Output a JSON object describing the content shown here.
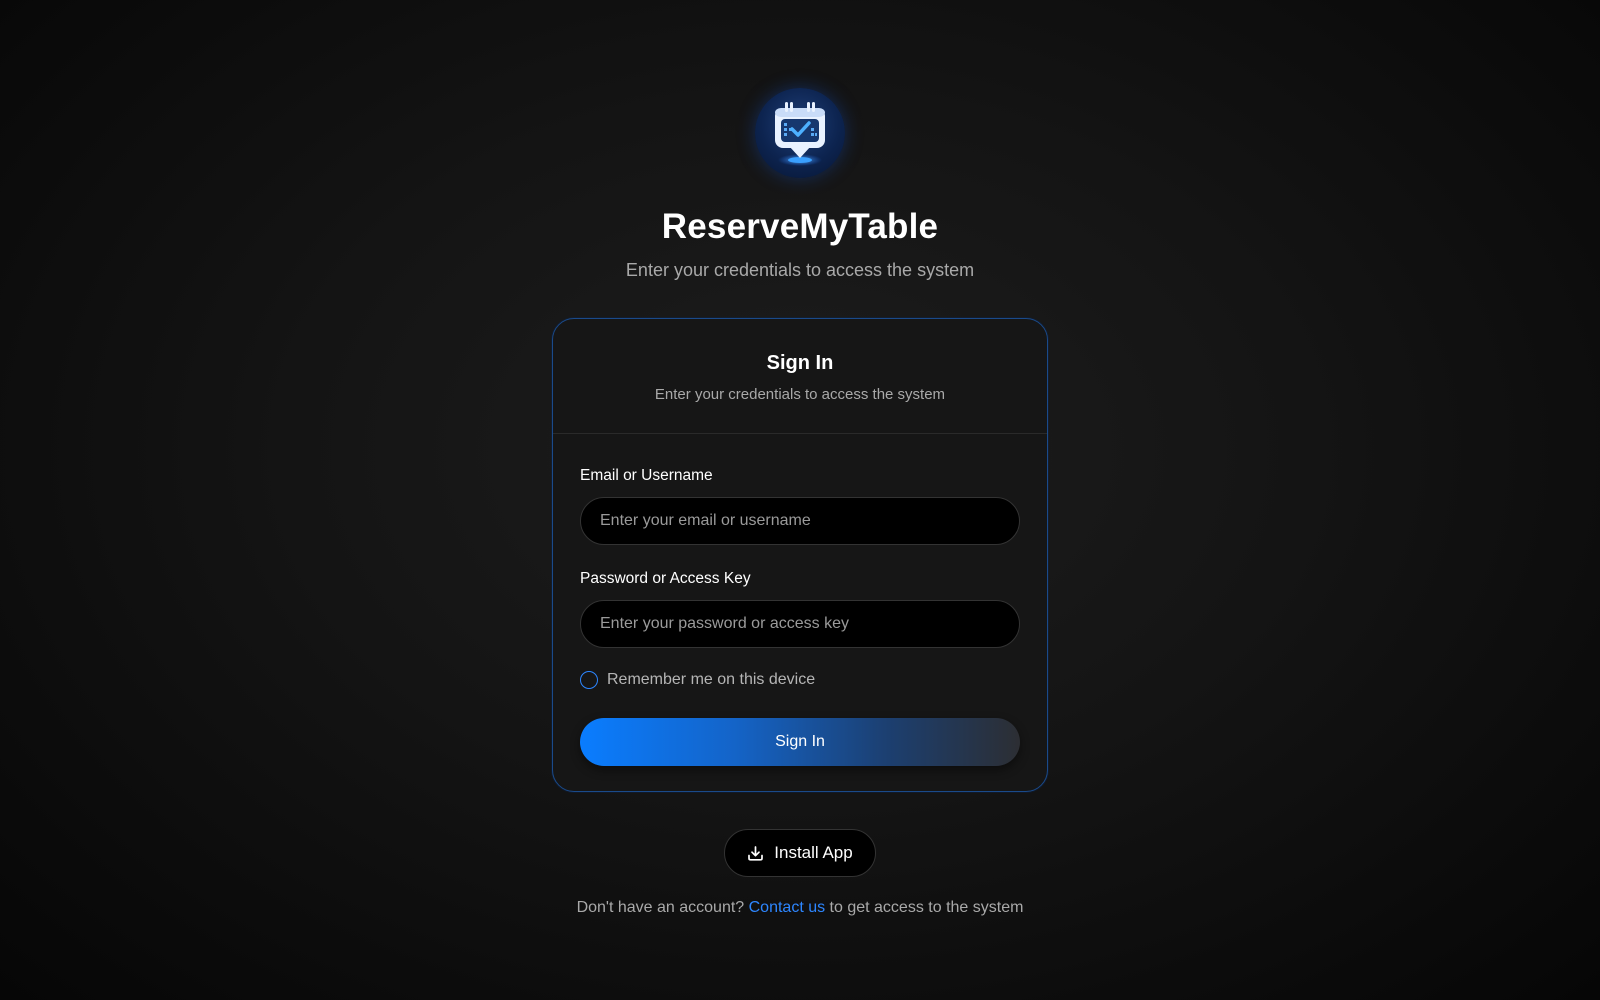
{
  "app": {
    "name": "ReserveMyTable",
    "subtitle": "Enter your credentials to access the system"
  },
  "card": {
    "title": "Sign In",
    "subtitle": "Enter your credentials to access the system"
  },
  "form": {
    "email_label": "Email or Username",
    "email_placeholder": "Enter your email or username",
    "email_value": "",
    "password_label": "Password or Access Key",
    "password_placeholder": "Enter your password or access key",
    "password_value": "",
    "remember_label": "Remember me on this device",
    "remember_checked": false,
    "submit_label": "Sign In"
  },
  "install": {
    "label": "Install App",
    "icon": "download-icon"
  },
  "footer": {
    "prefix": "Don't have an account? ",
    "link_label": "Contact us",
    "suffix": " to get access to the system"
  },
  "colors": {
    "accent": "#0a7dff",
    "card_border": "#1a4a8a",
    "background": "#141414"
  },
  "logo": {
    "icon": "calendar-check-pin-icon"
  }
}
